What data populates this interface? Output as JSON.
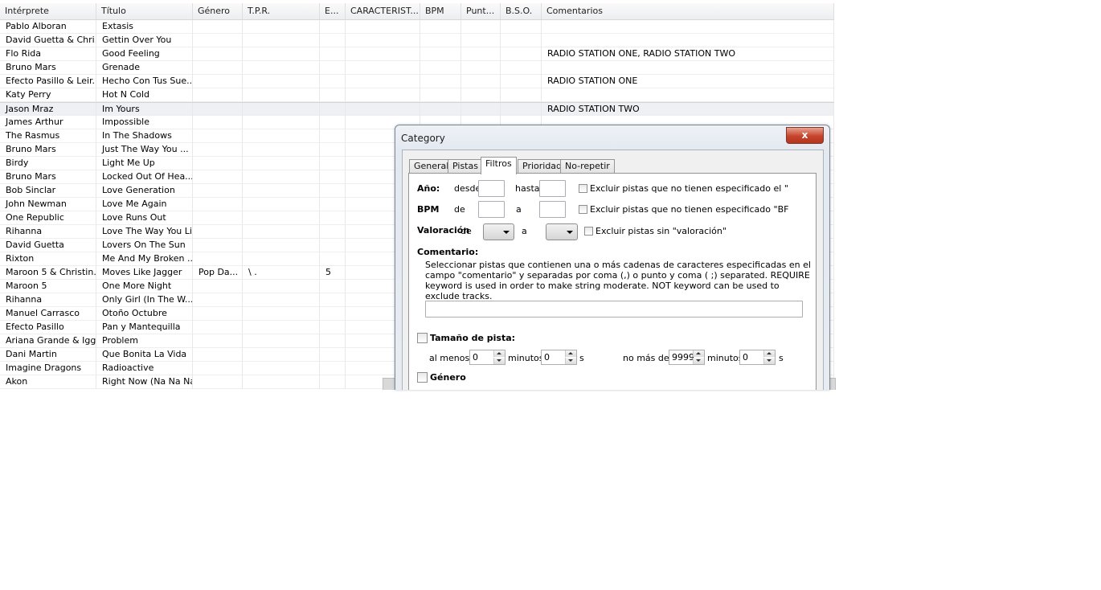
{
  "grid": {
    "columns": [
      {
        "key": "interprete",
        "label": "Intérprete"
      },
      {
        "key": "titulo",
        "label": "Título"
      },
      {
        "key": "genero",
        "label": "Género"
      },
      {
        "key": "tpr",
        "label": "T.P.R."
      },
      {
        "key": "e",
        "label": "E..."
      },
      {
        "key": "caracteristicas",
        "label": "CARACTERIST..."
      },
      {
        "key": "bpm",
        "label": "BPM"
      },
      {
        "key": "puntuacion",
        "label": "Punt..."
      },
      {
        "key": "bso",
        "label": "B.S.O."
      },
      {
        "key": "comentarios",
        "label": "Comentarios"
      }
    ],
    "rows": [
      {
        "interprete": "Pablo Alboran",
        "titulo": "Extasis",
        "comentarios": ""
      },
      {
        "interprete": "David Guetta & Chri...",
        "titulo": "Gettin Over You",
        "comentarios": ""
      },
      {
        "interprete": "Flo Rida",
        "titulo": "Good Feeling",
        "comentarios": "RADIO STATION ONE, RADIO STATION TWO"
      },
      {
        "interprete": "Bruno Mars",
        "titulo": "Grenade",
        "comentarios": ""
      },
      {
        "interprete": "Efecto Pasillo & Leir...",
        "titulo": "Hecho Con Tus Sue...",
        "comentarios": "RADIO STATION ONE"
      },
      {
        "interprete": "Katy Perry",
        "titulo": "Hot N Cold",
        "comentarios": ""
      },
      {
        "interprete": "Jason Mraz",
        "titulo": "Im Yours",
        "comentarios": "RADIO STATION TWO",
        "selected": true
      },
      {
        "interprete": "James Arthur",
        "titulo": "Impossible",
        "comentarios": ""
      },
      {
        "interprete": "The Rasmus",
        "titulo": "In The Shadows",
        "comentarios": ""
      },
      {
        "interprete": "Bruno Mars",
        "titulo": "Just The Way You ...",
        "comentarios": ""
      },
      {
        "interprete": "Birdy",
        "titulo": "Light Me Up",
        "comentarios": ""
      },
      {
        "interprete": "Bruno Mars",
        "titulo": "Locked Out Of Hea...",
        "comentarios": ""
      },
      {
        "interprete": "Bob Sinclar",
        "titulo": "Love Generation",
        "comentarios": ""
      },
      {
        "interprete": "John Newman",
        "titulo": "Love Me Again",
        "comentarios": ""
      },
      {
        "interprete": "One Republic",
        "titulo": "Love Runs Out",
        "comentarios": ""
      },
      {
        "interprete": "Rihanna",
        "titulo": "Love The Way You Lie",
        "comentarios": ""
      },
      {
        "interprete": "David Guetta",
        "titulo": "Lovers On The Sun",
        "comentarios": ""
      },
      {
        "interprete": "Rixton",
        "titulo": "Me And My Broken ...",
        "comentarios": ""
      },
      {
        "interprete": "Maroon 5 & Christin...",
        "titulo": "Moves Like Jagger",
        "genero": "Pop Da...",
        "tpr": "\\                 .",
        "e": "5",
        "comentarios": ""
      },
      {
        "interprete": "Maroon 5",
        "titulo": "One More Night",
        "comentarios": ""
      },
      {
        "interprete": "Rihanna",
        "titulo": "Only Girl (In The W...",
        "comentarios": ""
      },
      {
        "interprete": "Manuel Carrasco",
        "titulo": "Otoño Octubre",
        "comentarios": ""
      },
      {
        "interprete": "Efecto Pasillo",
        "titulo": "Pan y Mantequilla",
        "comentarios": ""
      },
      {
        "interprete": "Ariana Grande & Igg...",
        "titulo": "Problem",
        "comentarios": ""
      },
      {
        "interprete": "Dani Martin",
        "titulo": "Que Bonita La Vida",
        "comentarios": ""
      },
      {
        "interprete": "Imagine Dragons",
        "titulo": "Radioactive",
        "comentarios": ""
      },
      {
        "interprete": "Akon",
        "titulo": "Right Now (Na Na Na)",
        "comentarios": ""
      }
    ]
  },
  "dialog": {
    "title": "Category",
    "close_glyph": "x",
    "tabs": [
      "General",
      "Pistas",
      "Filtros",
      "Prioridad",
      "No-repetir"
    ],
    "active_tab": "Filtros",
    "ano": {
      "label": "Año:",
      "from_label": "desde",
      "to_label": "hasta",
      "from_value": "",
      "to_value": "",
      "exclude_label": "Excluir pistas que no tienen especificado el \""
    },
    "bpm": {
      "label": "BPM",
      "from_label": "de",
      "to_label": "a",
      "from_value": "",
      "to_value": "",
      "exclude_label": "Excluir pistas que no tienen especificado \"BF"
    },
    "valoracion": {
      "label": "Valoración",
      "from_label": "de",
      "to_label": "a",
      "exclude_label": "Excluir pistas sin \"valoración\""
    },
    "comentario": {
      "label": "Comentario:",
      "description": "Seleccionar pistas que contienen una o más cadenas de caracteres especificadas en el campo \"comentario\" y separadas por coma (,) o punto y coma ( ;) separated. REQUIRE keyword is used in order to make string moderate. NOT keyword can be used to exclude tracks.",
      "value": ""
    },
    "tamano": {
      "label": "Tamaño de  pista:",
      "al_menos_label": "al menos",
      "min_minutes": "0",
      "minutos_label": "minutos",
      "min_seconds": "0",
      "s_label": "s",
      "no_mas_de_label": "no más de",
      "max_minutes": "9999",
      "max_seconds": "0"
    },
    "genero": {
      "label": "Género"
    }
  }
}
